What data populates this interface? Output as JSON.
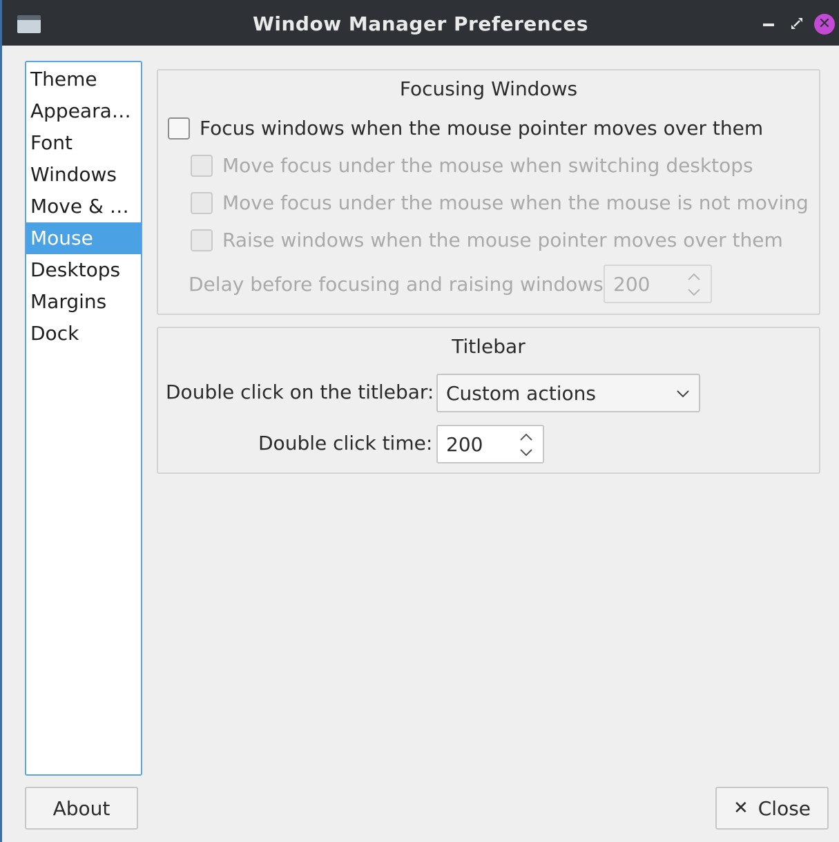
{
  "window": {
    "title": "Window Manager Preferences"
  },
  "sidebar": {
    "items": [
      {
        "label": "Theme"
      },
      {
        "label": "Appeara…"
      },
      {
        "label": "Font"
      },
      {
        "label": "Windows"
      },
      {
        "label": "Move & …"
      },
      {
        "label": "Mouse",
        "selected": true
      },
      {
        "label": "Desktops"
      },
      {
        "label": "Margins"
      },
      {
        "label": "Dock"
      }
    ]
  },
  "focusing": {
    "heading": "Focusing Windows",
    "focus_on_hover": {
      "label": "Focus windows when the mouse pointer moves over them",
      "checked": false
    },
    "move_focus_switching": {
      "label": "Move focus under the mouse when switching desktops",
      "checked": false,
      "disabled": true
    },
    "move_focus_not_moving": {
      "label": "Move focus under the mouse when the mouse is not moving",
      "checked": false,
      "disabled": true
    },
    "raise_on_hover": {
      "label": "Raise windows when the mouse pointer moves over them",
      "checked": false,
      "disabled": true
    },
    "delay_label": "Delay before focusing and raising windows:",
    "delay_value": "200"
  },
  "titlebar": {
    "heading": "Titlebar",
    "double_click_label": "Double click on the titlebar:",
    "double_click_value": "Custom actions",
    "double_click_time_label": "Double click time:",
    "double_click_time_value": "200"
  },
  "buttons": {
    "about": "About",
    "close": "Close",
    "close_icon": "✕"
  },
  "colors": {
    "selection": "#4aa1e3",
    "titlebar_bg": "#2e3236",
    "close_btn": "#c34ad4"
  }
}
